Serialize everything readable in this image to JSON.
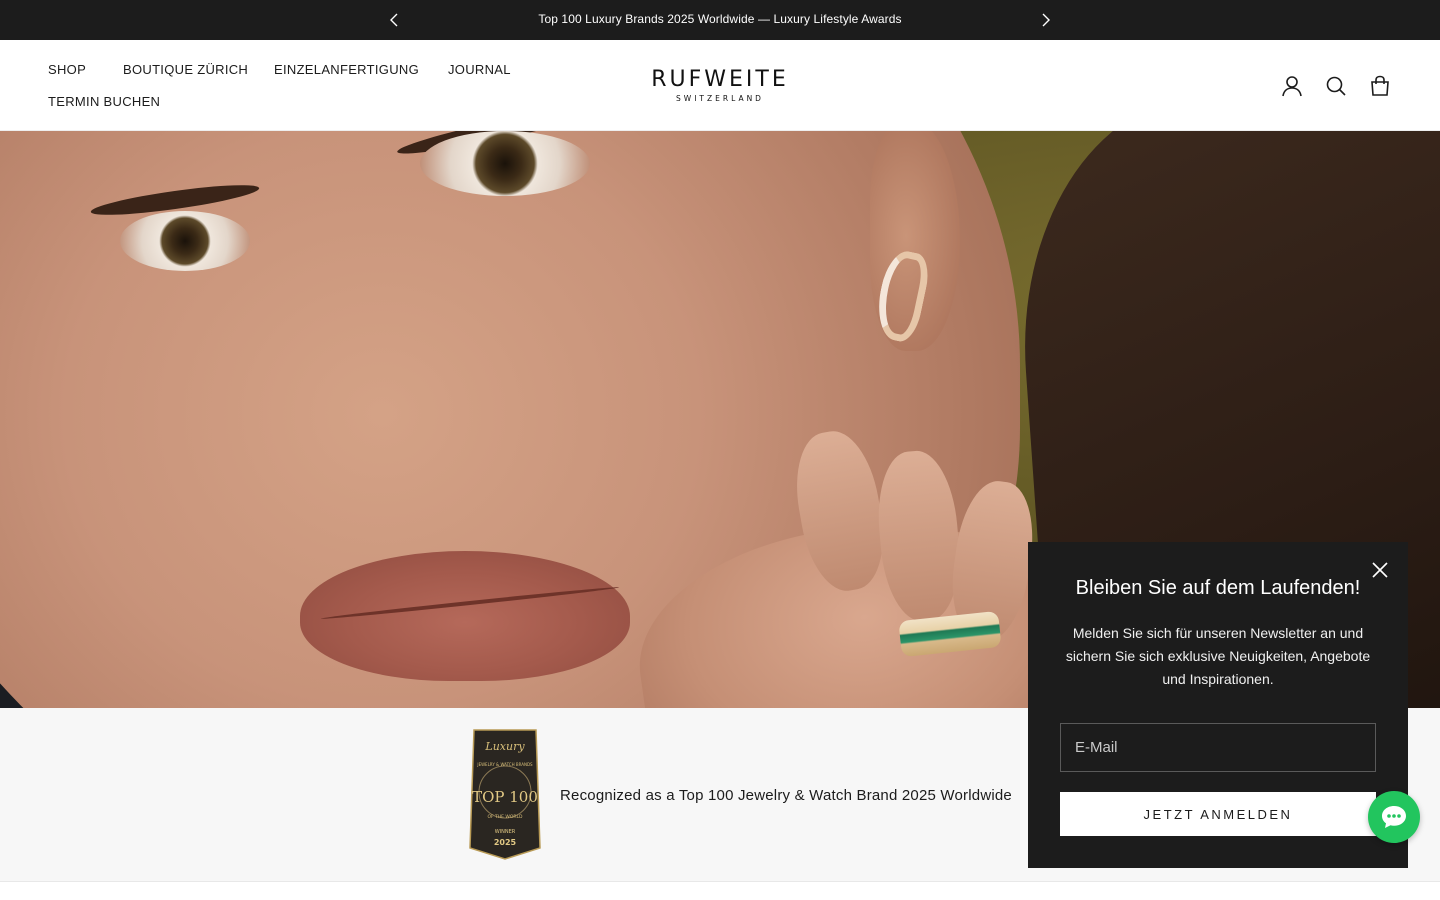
{
  "announcement": {
    "text": "Top 100 Luxury Brands 2025 Worldwide — Luxury Lifestyle Awards",
    "prev_icon": "chevron-left-icon",
    "next_icon": "chevron-right-icon"
  },
  "header": {
    "nav": [
      "SHOP",
      "BOUTIQUE ZÜRICH",
      "EINZELANFERTIGUNG",
      "JOURNAL",
      "TERMIN BUCHEN"
    ],
    "logo": {
      "brand": "RUFWEITE",
      "sub": "SWITZERLAND"
    },
    "icons": [
      "account-icon",
      "search-icon",
      "cart-icon"
    ]
  },
  "award": {
    "badge": {
      "script": "Luxury",
      "arc": "JEWELRY & WATCH BRANDS",
      "main": "TOP 100",
      "sub": "OF THE WORLD",
      "winner": "WINNER",
      "year": "2025"
    },
    "text": "Recognized as a Top 100 Jewelry & Watch Brand 2025 Worldwide"
  },
  "newsletter": {
    "title": "Bleiben Sie auf dem Laufenden!",
    "description": "Melden Sie sich für unseren Newsletter an und sichern Sie sich exklusive Neuigkeiten, Angebote und Inspirationen.",
    "email_placeholder": "E-Mail",
    "email_value": "",
    "submit_label": "JETZT ANMELDEN",
    "close_icon": "close-icon"
  },
  "chat": {
    "icon": "chat-bubble-icon"
  },
  "colors": {
    "dark": "#1c1c1c",
    "chat": "#22c55e",
    "hero_bg": "#5f5623",
    "strip_bg": "#f7f7f7"
  }
}
